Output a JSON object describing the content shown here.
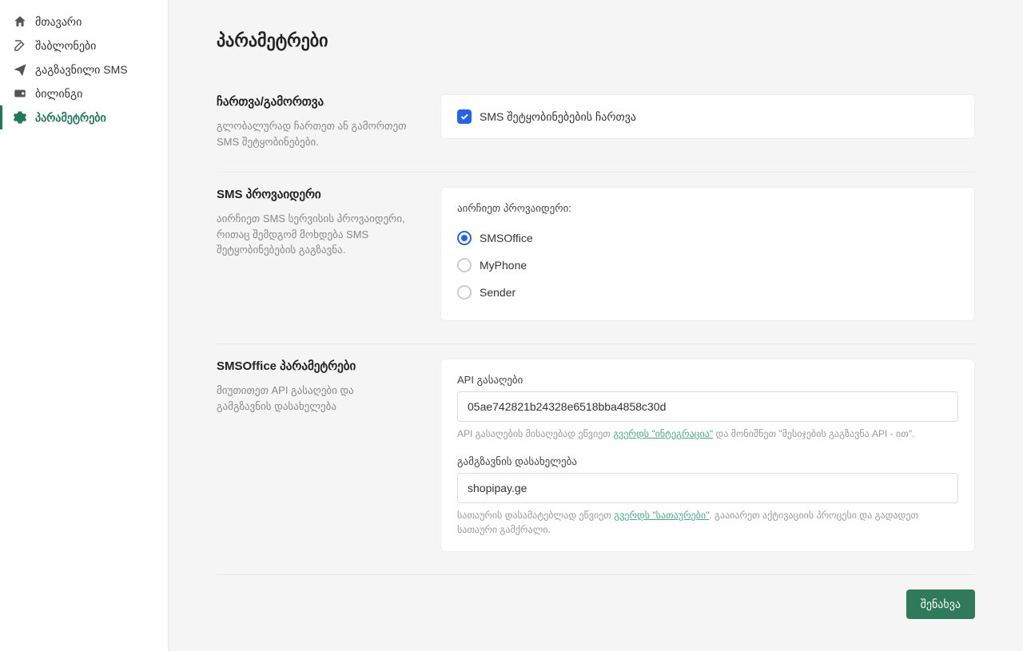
{
  "sidebar": {
    "items": [
      {
        "label": "მთავარი",
        "icon": "home"
      },
      {
        "label": "შაბლონები",
        "icon": "edit"
      },
      {
        "label": "გაგზავნილი SMS",
        "icon": "send"
      },
      {
        "label": "ბილინგი",
        "icon": "wallet"
      },
      {
        "label": "პარამეტრები",
        "icon": "gear",
        "active": true
      }
    ]
  },
  "page": {
    "title": "პარამეტრები"
  },
  "sections": {
    "toggle": {
      "title": "ჩართვა/გამორთვა",
      "desc": "გლობალურად ჩართეთ ან გამორთეთ SMS შეტყობინებები.",
      "checkbox_label": "SMS შეტყობინებების ჩართვა"
    },
    "provider": {
      "title": "SMS პროვაიდერი",
      "desc": "აირჩიეთ SMS სერვისის პროვაიდერი, რითაც შემდგომ მოხდება SMS შეტყობინებების გაგზავნა.",
      "choose_label": "აირჩიეთ პროვაიდერი:",
      "options": [
        {
          "label": "SMSOffice",
          "selected": true
        },
        {
          "label": "MyPhone",
          "selected": false
        },
        {
          "label": "Sender",
          "selected": false
        }
      ]
    },
    "smsoffice": {
      "title": "SMSOffice პარამეტრები",
      "desc": "მიუთითეთ API გასაღები და გამგზავნის დასახელება",
      "api_key_label": "API გასაღები",
      "api_key_value": "05ae742821b24328e6518bba4858c30d",
      "api_hint_before": "API გასაღების მისაღებად ეწვიეთ ",
      "api_hint_link": "გვერდს \"ინტეგრაცია\"",
      "api_hint_after": " და მონიშნეთ \"მესიჯების გაგზავნა API - ით\".",
      "sender_label": "გამგზავნის დასახელება",
      "sender_value": "shopipay.ge",
      "sender_hint_before": "სათაურის დასამატებლად ეწვიეთ ",
      "sender_hint_link": "გვერდს \"სათაურები\"",
      "sender_hint_after": ". გააიარეთ აქტივაციის პროცესი და გადადეთ სათაური გამქრალი."
    }
  },
  "actions": {
    "save": "შენახვა"
  }
}
